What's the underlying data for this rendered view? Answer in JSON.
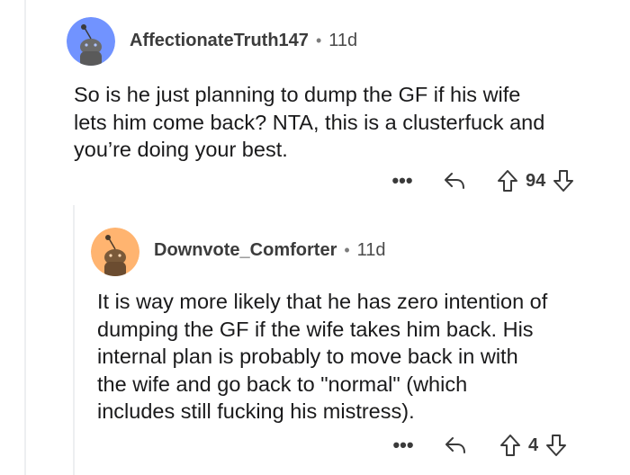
{
  "comments": [
    {
      "username": "AffectionateTruth147",
      "separator": "•",
      "age": "11d",
      "text": "So is he just planning to dump the GF if his wife\nlets him come back?  NTA, this is a clusterfuck and\nyou’re doing your best.",
      "more": "•••",
      "score": "94",
      "avatar_color": "#7193ff"
    },
    {
      "username": "Downvote_Comforter",
      "separator": "•",
      "age": "11d",
      "text": "It is way more likely that he has zero intention of\ndumping the GF if the wife takes him back. His\ninternal plan is probably to move back in with\nthe wife and go back to \"normal\" (which\nincludes still fucking his mistress).",
      "more": "•••",
      "score": "4",
      "avatar_color": "#ffb470"
    }
  ],
  "icons": {
    "reply": "reply-icon",
    "upvote": "upvote-arrow-icon",
    "downvote": "downvote-arrow-icon",
    "avatar": "snoo-avatar-icon"
  },
  "colors": {
    "text": "#1a1a1b",
    "meta": "#7c7c7c",
    "thread_line": "#edeff1"
  }
}
